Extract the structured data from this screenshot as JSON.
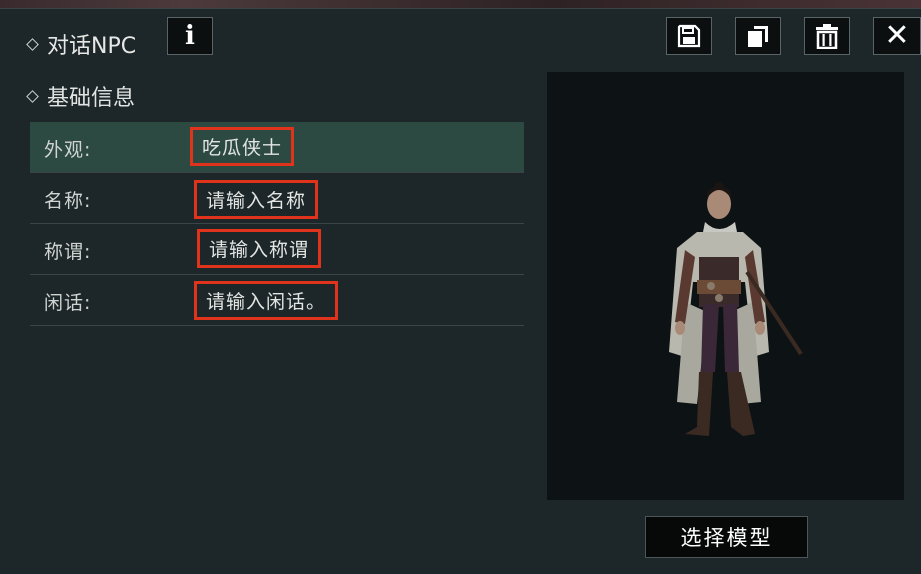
{
  "header": {
    "title": "对话NPC",
    "info_label": "i",
    "close_label": "✕",
    "icons": [
      "save-icon",
      "copy-icon",
      "delete-icon",
      "close-icon"
    ]
  },
  "section": {
    "title": "基础信息"
  },
  "fields": [
    {
      "label": "外观:",
      "value": "吃瓜侠士"
    },
    {
      "label": "名称:",
      "value": "请输入名称"
    },
    {
      "label": "称谓:",
      "value": "请输入称谓"
    },
    {
      "label": "闲话:",
      "value": "请输入闲话。"
    }
  ],
  "preview": {
    "button_label": "选择模型"
  },
  "colors": {
    "highlight_box": "#e0331c",
    "active_row": "#2d4a42",
    "panel_bg": "#1d2628"
  }
}
